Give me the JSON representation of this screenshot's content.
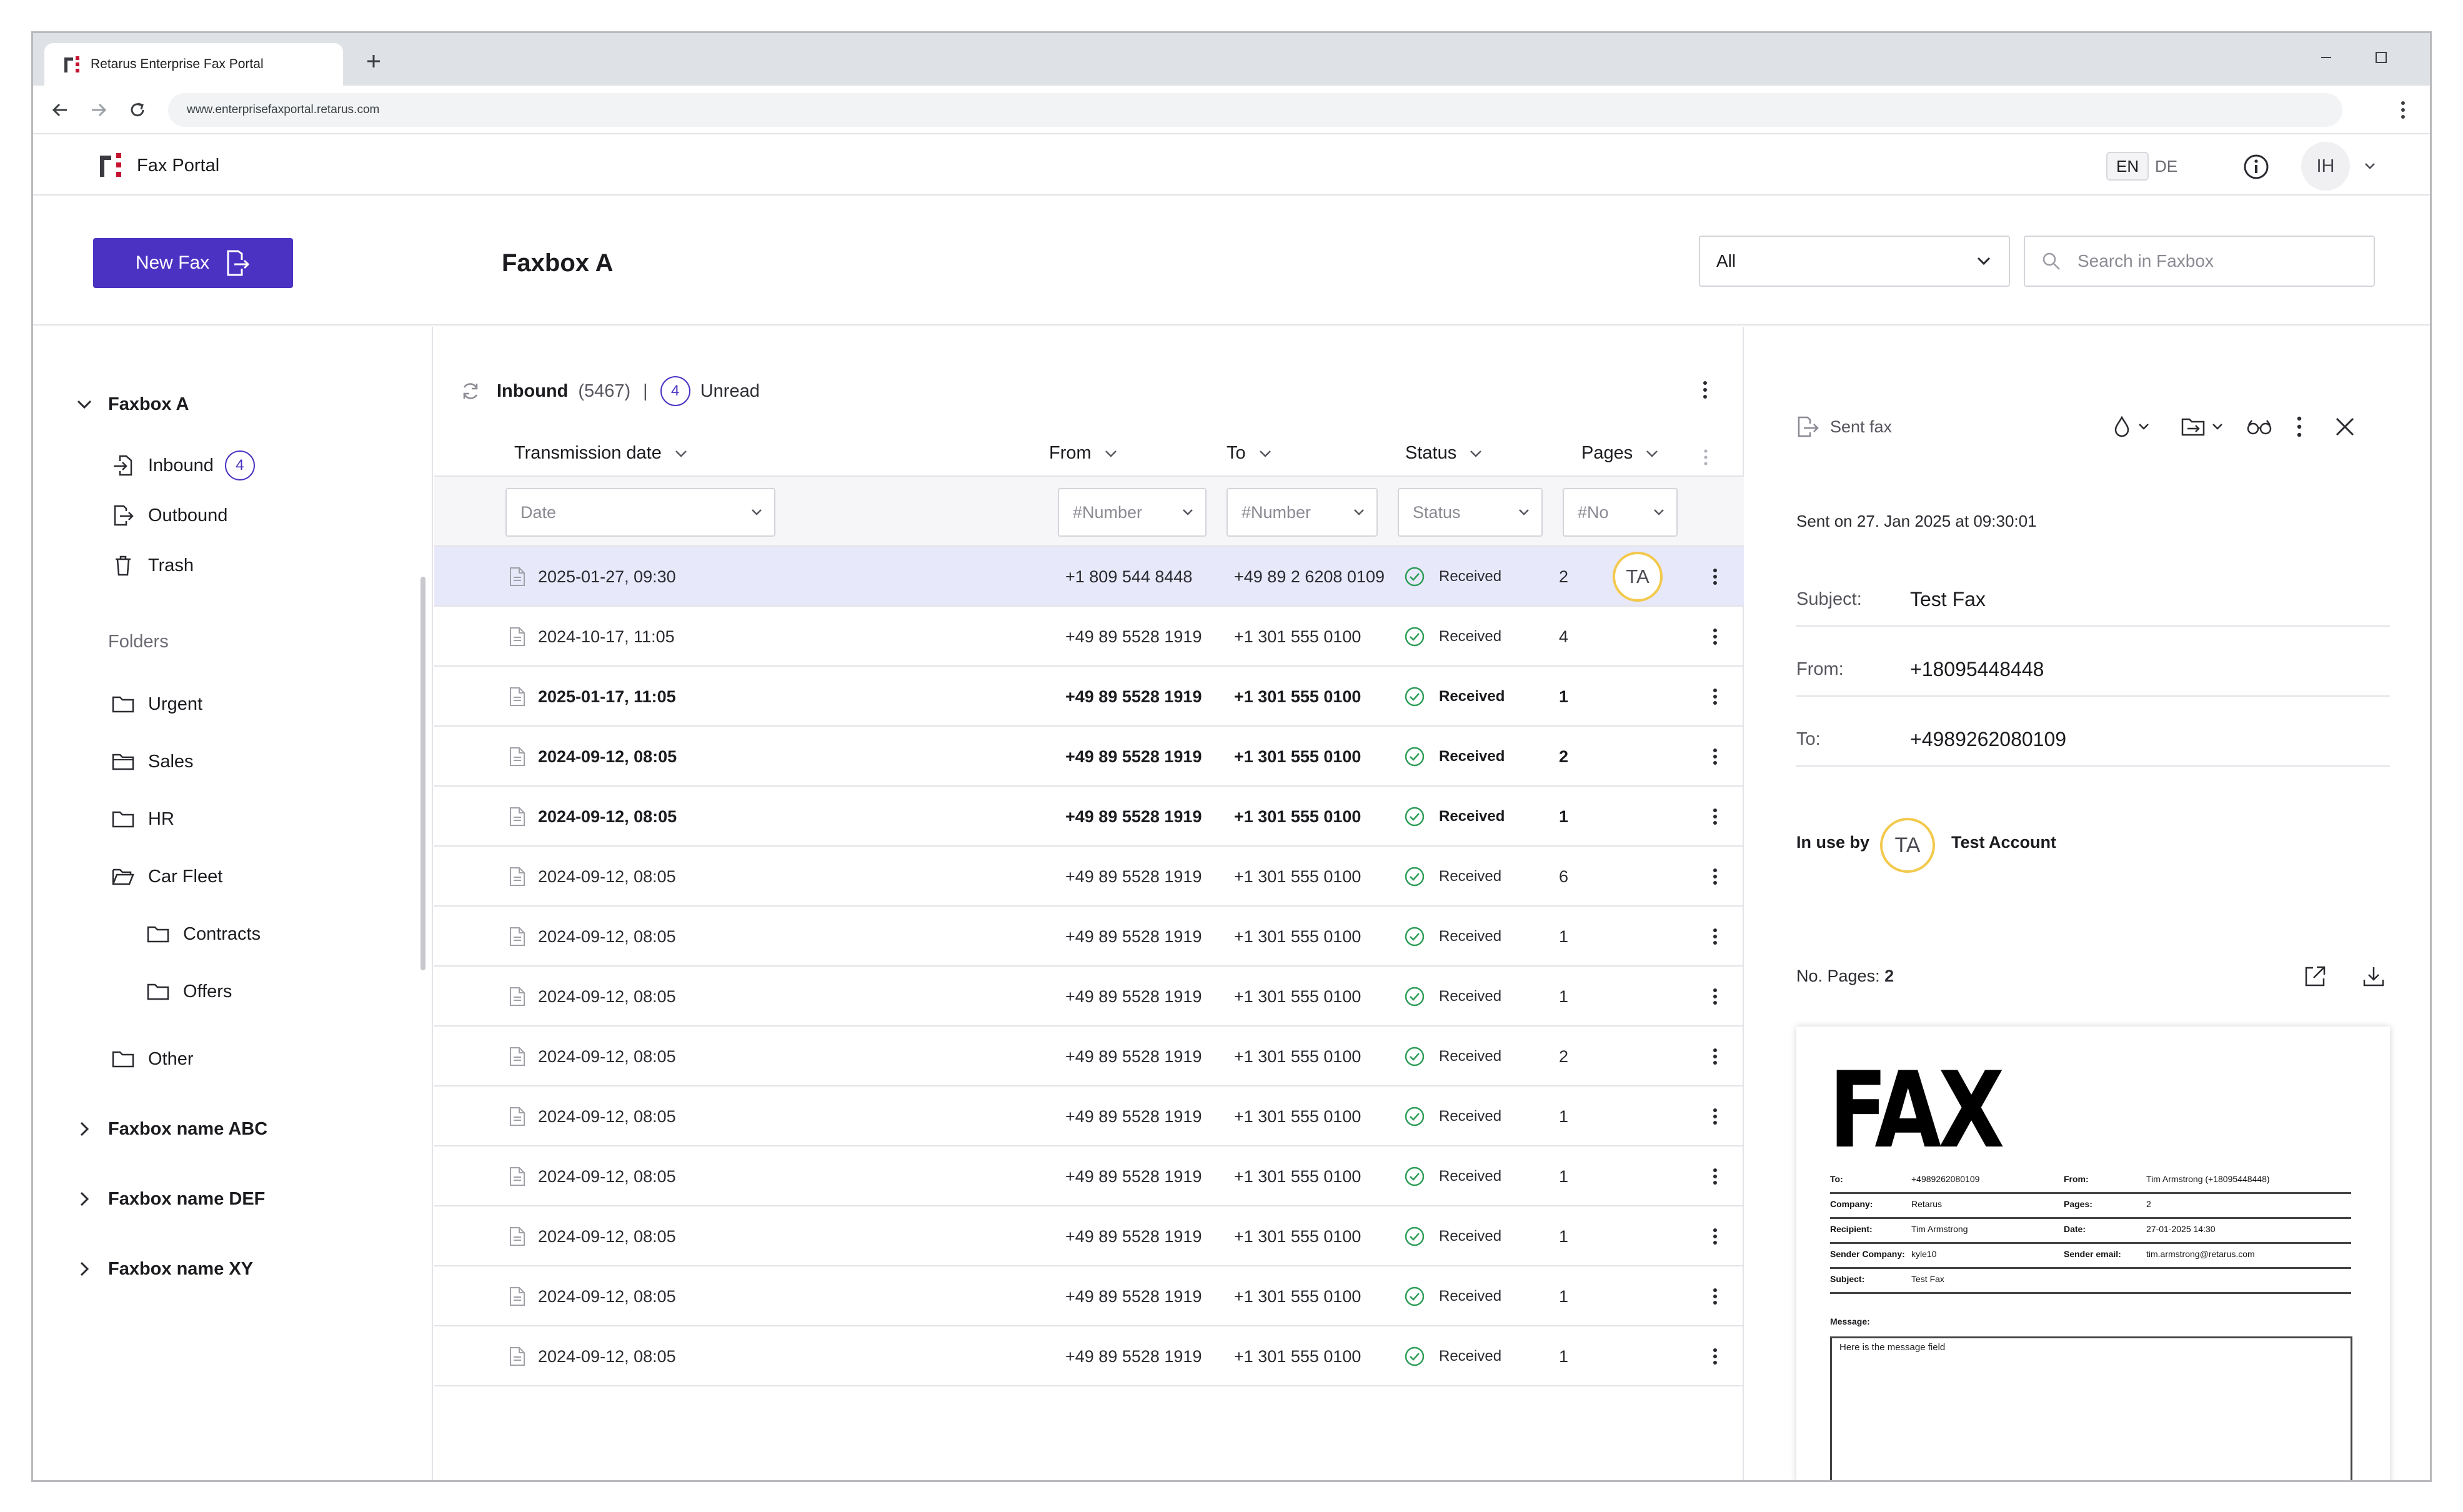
{
  "browser": {
    "tab_title": "Retarus Enterprise Fax Portal",
    "url": "www.enterprisefaxportal.retarus.com"
  },
  "header": {
    "app_title": "Fax Portal",
    "lang_en": "EN",
    "lang_de": "DE",
    "user_initials": "IH"
  },
  "toolbar": {
    "new_fax_label": "New Fax",
    "page_title": "Faxbox A",
    "filter_value": "All",
    "search_placeholder": "Search in Faxbox"
  },
  "sidebar": {
    "faxbox_a": "Faxbox A",
    "inbound": "Inbound",
    "inbound_badge": "4",
    "outbound": "Outbound",
    "trash": "Trash",
    "folders_heading": "Folders",
    "folders": [
      "Urgent",
      "Sales",
      "HR",
      "Car Fleet",
      "Contracts",
      "Offers",
      "Other"
    ],
    "faxboxes": [
      "Faxbox name ABC",
      "Faxbox name DEF",
      "Faxbox name XY"
    ]
  },
  "list": {
    "title": "Inbound",
    "count": "(5467)",
    "separator": "|",
    "unread_count": "4",
    "unread_label": "Unread",
    "columns": {
      "date": "Transmission date",
      "from": "From",
      "to": "To",
      "status": "Status",
      "pages": "Pages"
    },
    "filters": {
      "date": "Date",
      "from": "#Number",
      "to": "#Number",
      "status": "Status",
      "pages": "#No"
    },
    "rows": [
      {
        "date": "2025-01-27, 09:30",
        "from": "+1 809 544 8448",
        "to": "+49 89 2 6208 0109",
        "status": "Received",
        "pages": "2",
        "user": "TA"
      },
      {
        "date": "2024-10-17, 11:05",
        "from": "+49 89 5528 1919",
        "to": "+1 301 555 0100",
        "status": "Received",
        "pages": "4"
      },
      {
        "date": "2025-01-17, 11:05",
        "from": "+49 89 5528 1919",
        "to": "+1 301 555 0100",
        "status": "Received",
        "pages": "1"
      },
      {
        "date": "2024-09-12, 08:05",
        "from": "+49 89 5528 1919",
        "to": "+1 301 555 0100",
        "status": "Received",
        "pages": "2"
      },
      {
        "date": "2024-09-12, 08:05",
        "from": "+49 89 5528 1919",
        "to": "+1 301 555 0100",
        "status": "Received",
        "pages": "1"
      },
      {
        "date": "2024-09-12, 08:05",
        "from": "+49 89 5528 1919",
        "to": "+1 301 555 0100",
        "status": "Received",
        "pages": "6"
      },
      {
        "date": "2024-09-12, 08:05",
        "from": "+49 89 5528 1919",
        "to": "+1 301 555 0100",
        "status": "Received",
        "pages": "1"
      },
      {
        "date": "2024-09-12, 08:05",
        "from": "+49 89 5528 1919",
        "to": "+1 301 555 0100",
        "status": "Received",
        "pages": "1"
      },
      {
        "date": "2024-09-12, 08:05",
        "from": "+49 89 5528 1919",
        "to": "+1 301 555 0100",
        "status": "Received",
        "pages": "2"
      },
      {
        "date": "2024-09-12, 08:05",
        "from": "+49 89 5528 1919",
        "to": "+1 301 555 0100",
        "status": "Received",
        "pages": "1"
      },
      {
        "date": "2024-09-12, 08:05",
        "from": "+49 89 5528 1919",
        "to": "+1 301 555 0100",
        "status": "Received",
        "pages": "1"
      },
      {
        "date": "2024-09-12, 08:05",
        "from": "+49 89 5528 1919",
        "to": "+1 301 555 0100",
        "status": "Received",
        "pages": "1"
      },
      {
        "date": "2024-09-12, 08:05",
        "from": "+49 89 5528 1919",
        "to": "+1 301 555 0100",
        "status": "Received",
        "pages": "1"
      },
      {
        "date": "2024-09-12, 08:05",
        "from": "+49 89 5528 1919",
        "to": "+1 301 555 0100",
        "status": "Received",
        "pages": "1"
      }
    ],
    "selected_row": 0,
    "bold_rows": [
      2,
      3,
      4
    ]
  },
  "detail": {
    "kind": "Sent fax",
    "sent_on": "Sent on 27. Jan 2025 at 09:30:01",
    "subject_label": "Subject:",
    "subject": "Test Fax",
    "from_label": "From:",
    "from": "+18095448448",
    "to_label": "To:",
    "to": "+4989262080109",
    "in_use_label": "In use by",
    "in_use_initials": "TA",
    "in_use_name": "Test Account",
    "pages_label": "No. Pages:",
    "pages": "2"
  },
  "fax_document": {
    "title": "FAX",
    "to_label": "To:",
    "to": "+4989262080109",
    "from_label": "From:",
    "from": "Tim Armstrong (+18095448448)",
    "company_label": "Company:",
    "company": "Retarus",
    "pages_label": "Pages:",
    "pages": "2",
    "recipient_label": "Recipient:",
    "recipient": "Tim Armstrong",
    "date_label": "Date:",
    "date": "27-01-2025 14:30",
    "sender_company_label": "Sender Company:",
    "sender_company": "kyle10",
    "sender_email_label": "Sender email:",
    "sender_email": "tim.armstrong@retarus.com",
    "subject_label": "Subject:",
    "subject": "Test Fax",
    "message_label": "Message:",
    "message": "Here is the message field"
  },
  "colors": {
    "accent": "#4b32c3",
    "selected_row": "#e8e8fb",
    "status_green": "#2e9e58",
    "chip_ring": "#f2c94c",
    "brand_red": "#c4122f"
  }
}
